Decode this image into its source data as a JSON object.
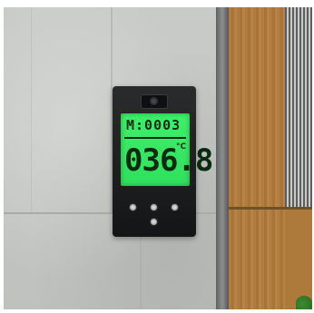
{
  "display": {
    "memory_label": "M:0003",
    "temperature": "036.8",
    "unit": "°C"
  },
  "colors": {
    "lcd_green": "#3df06a",
    "device_body": "#1b1c1e",
    "wall": "#c6c8c5",
    "wood": "#b07d3e"
  }
}
